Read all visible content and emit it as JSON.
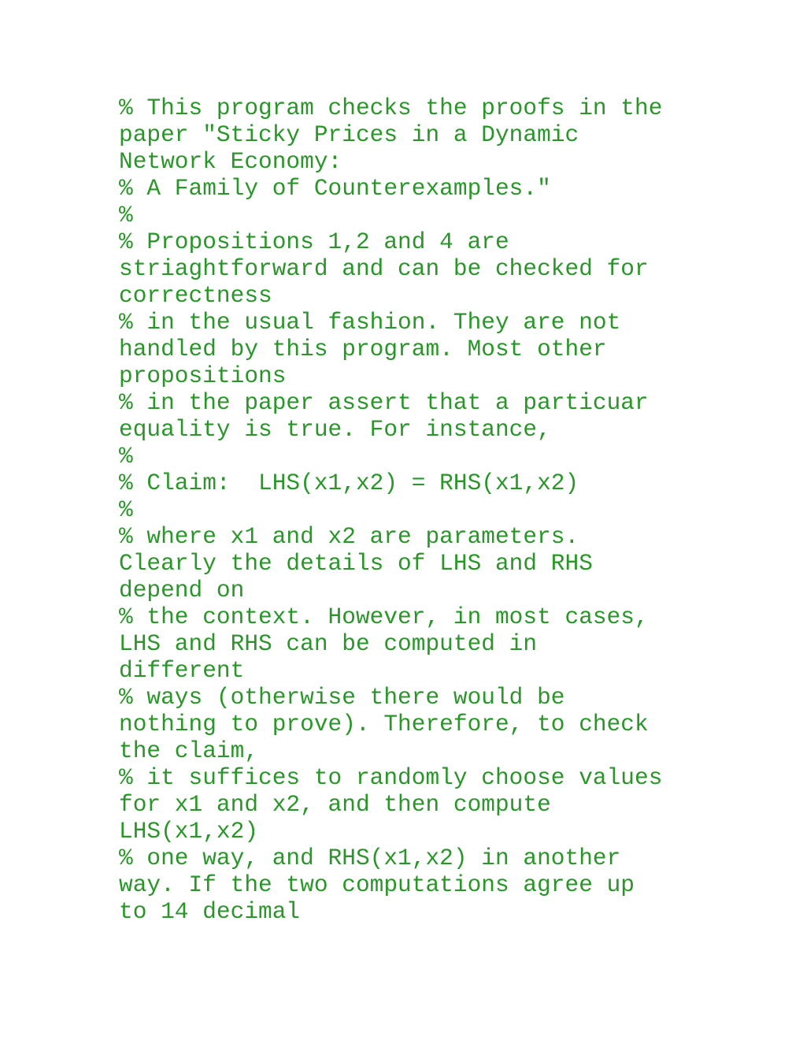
{
  "document": {
    "text_color": "#2a962a",
    "lines": [
      "% This program checks the proofs in the",
      "paper \"Sticky Prices in a Dynamic",
      "Network Economy:",
      "% A Family of Counterexamples.\"",
      "%",
      "% Propositions 1,2 and 4 are",
      "striaghtforward and can be checked for",
      "correctness",
      "% in the usual fashion. They are not",
      "handled by this program. Most other",
      "propositions",
      "% in the paper assert that a particuar",
      "equality is true. For instance,",
      "%",
      "% Claim:  LHS(x1,x2) = RHS(x1,x2)",
      "%",
      "% where x1 and x2 are parameters.",
      "Clearly the details of LHS and RHS",
      "depend on",
      "% the context. However, in most cases,",
      "LHS and RHS can be computed in",
      "different",
      "% ways (otherwise there would be",
      "nothing to prove). Therefore, to check",
      "the claim,",
      "% it suffices to randomly choose values",
      "for x1 and x2, and then compute",
      "LHS(x1,x2)",
      "% one way, and RHS(x1,x2) in another",
      "way. If the two computations agree up",
      "to 14 decimal"
    ]
  }
}
